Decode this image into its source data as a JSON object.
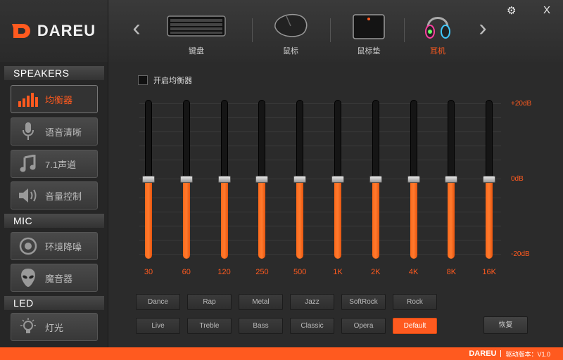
{
  "brand": {
    "name": "DAREU"
  },
  "devices": [
    {
      "label": "键盘",
      "icon": "keyboard-icon"
    },
    {
      "label": "鼠标",
      "icon": "mouse-icon"
    },
    {
      "label": "鼠标垫",
      "icon": "mousepad-icon"
    },
    {
      "label": "耳机",
      "icon": "headset-icon",
      "active": true
    }
  ],
  "window": {
    "settings_icon": "gear-icon",
    "close_label": "X"
  },
  "sidebar": {
    "sections": [
      {
        "title": "SPEAKERS"
      },
      {
        "title": "MIC"
      },
      {
        "title": "LED"
      }
    ],
    "items": [
      {
        "label": "均衡器",
        "icon": "equalizer-icon",
        "active": true
      },
      {
        "label": "语音清晰",
        "icon": "microphone-icon"
      },
      {
        "label": "7.1声道",
        "icon": "music-note-icon"
      },
      {
        "label": "音量控制",
        "icon": "speaker-icon"
      },
      {
        "label": "环境降噪",
        "icon": "noise-cancel-icon"
      },
      {
        "label": "魔音器",
        "icon": "alien-icon"
      },
      {
        "label": "灯光",
        "icon": "light-bulb-icon"
      }
    ]
  },
  "equalizer": {
    "toggle_label": "开启均衡器",
    "toggle_checked": false,
    "db_labels": {
      "top": "+20dB",
      "mid": "0dB",
      "bottom": "-20dB"
    },
    "db_range": [
      -20,
      20
    ],
    "bands": [
      {
        "label": "30",
        "value": 0
      },
      {
        "label": "60",
        "value": 0
      },
      {
        "label": "120",
        "value": 0
      },
      {
        "label": "250",
        "value": 0
      },
      {
        "label": "500",
        "value": 0
      },
      {
        "label": "1K",
        "value": 0
      },
      {
        "label": "2K",
        "value": 0
      },
      {
        "label": "4K",
        "value": 0
      },
      {
        "label": "8K",
        "value": 0
      },
      {
        "label": "16K",
        "value": 0
      }
    ],
    "presets": [
      "Dance",
      "Rap",
      "Metal",
      "Jazz",
      "SoftRock",
      "Rock",
      "Live",
      "Treble",
      "Bass",
      "Classic",
      "Opera",
      "Default"
    ],
    "active_preset": "Default",
    "reset_label": "恢复",
    "accent_color": "#ff5a1f"
  },
  "footer": {
    "brand": "DAREU",
    "version": "驱动版本：V1.0"
  }
}
